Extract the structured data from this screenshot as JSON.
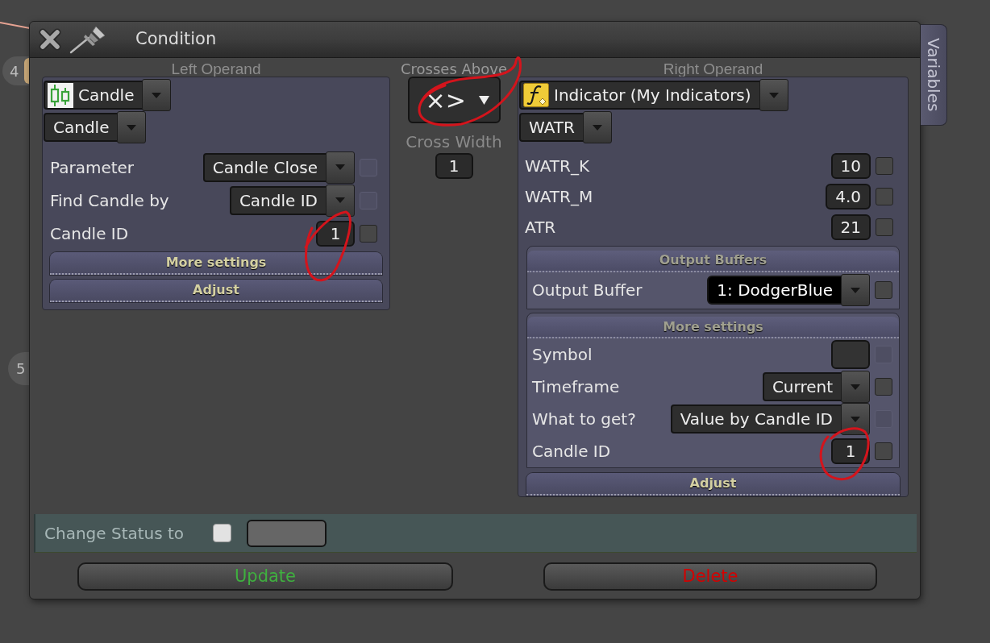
{
  "canvas": {
    "nodes": [
      {
        "label": "4"
      },
      {
        "label": "5"
      }
    ]
  },
  "window": {
    "title": "Condition"
  },
  "side_tab": {
    "label": "Variables"
  },
  "left_operand": {
    "heading": "Left Operand",
    "source": {
      "kind": "candle",
      "value": "Candle"
    },
    "subtype": "Candle",
    "rows": [
      {
        "label": "Parameter",
        "kind": "dropdown",
        "value": "Candle Close",
        "checkbox": {
          "checked": false,
          "disabled": true
        }
      },
      {
        "label": "Find Candle by",
        "kind": "dropdown",
        "value": "Candle ID",
        "checkbox": {
          "checked": false,
          "disabled": true
        }
      },
      {
        "label": "Candle ID",
        "kind": "input",
        "value": "1",
        "checkbox": {
          "checked": false,
          "disabled": false
        }
      }
    ],
    "sections": [
      {
        "title": "More settings",
        "expanded": false
      },
      {
        "title": "Adjust",
        "expanded": false
      }
    ]
  },
  "operator": {
    "heading": "Crosses Above",
    "value": "×>",
    "width_label": "Cross Width",
    "width_value": "1"
  },
  "right_operand": {
    "heading": "Right Operand",
    "source": {
      "kind": "indicator",
      "value": "Indicator (My Indicators)"
    },
    "subtype": "WATR",
    "rows": [
      {
        "label": "WATR_K",
        "kind": "input",
        "value": "10",
        "checkbox": {
          "checked": false,
          "disabled": false
        }
      },
      {
        "label": "WATR_M",
        "kind": "input",
        "value": "4.0",
        "checkbox": {
          "checked": false,
          "disabled": false
        }
      },
      {
        "label": "ATR",
        "kind": "input",
        "value": "21",
        "checkbox": {
          "checked": false,
          "disabled": false
        }
      }
    ],
    "sections": [
      {
        "title": "Output Buffers",
        "expanded": true,
        "rows": [
          {
            "label": "Output Buffer",
            "kind": "color_dropdown",
            "value": "1: DodgerBlue",
            "checkbox": {
              "checked": false,
              "disabled": false
            }
          }
        ]
      },
      {
        "title": "More settings",
        "expanded": true,
        "rows": [
          {
            "label": "Symbol",
            "kind": "input",
            "checkbox": {
              "checked": false,
              "disabled": true
            }
          },
          {
            "label": "Timeframe",
            "kind": "dropdown",
            "value": "Current",
            "checkbox": {
              "checked": false,
              "disabled": false
            }
          },
          {
            "label": "What to get?",
            "kind": "dropdown",
            "value": "Value by Candle ID",
            "checkbox": {
              "checked": false,
              "disabled": true
            }
          },
          {
            "label": "Candle ID",
            "kind": "input",
            "value": "1",
            "checkbox": {
              "checked": false,
              "disabled": false
            }
          }
        ]
      },
      {
        "title": "Adjust",
        "expanded": false
      }
    ]
  },
  "status": {
    "label": "Change Status to",
    "checked": false
  },
  "buttons": [
    {
      "label": "Update",
      "kind": "update"
    },
    {
      "label": "Delete",
      "kind": "delete"
    }
  ]
}
